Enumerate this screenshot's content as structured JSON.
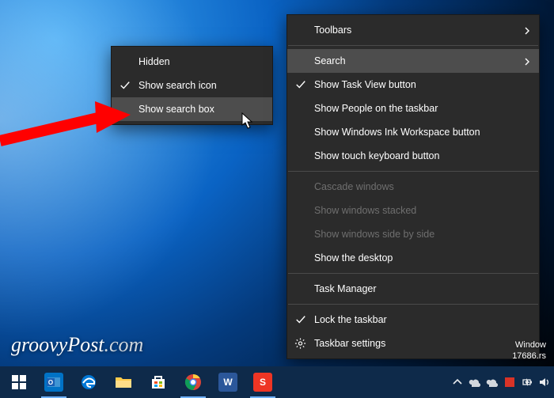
{
  "mainMenu": {
    "toolbars": "Toolbars",
    "search": "Search",
    "showTaskView": "Show Task View button",
    "showPeople": "Show People on the taskbar",
    "showInk": "Show Windows Ink Workspace button",
    "showTouchKb": "Show touch keyboard button",
    "cascade": "Cascade windows",
    "stacked": "Show windows stacked",
    "sideBySide": "Show windows side by side",
    "showDesktop": "Show the desktop",
    "taskManager": "Task Manager",
    "lockTaskbar": "Lock the taskbar",
    "taskbarSettings": "Taskbar settings"
  },
  "subMenu": {
    "hidden": "Hidden",
    "showIcon": "Show search icon",
    "showBox": "Show search box"
  },
  "watermark": {
    "g": "groovy",
    "p": "Post",
    "dot": ".com"
  },
  "winver": {
    "l1": "Window",
    "l2": "17686.rs"
  },
  "taskbarIcons": {
    "start": "start",
    "outlook": "outlook",
    "edge": "edge",
    "explorer": "explorer",
    "store": "store",
    "chrome": "chrome",
    "word": "word",
    "snagit": "snagit"
  }
}
